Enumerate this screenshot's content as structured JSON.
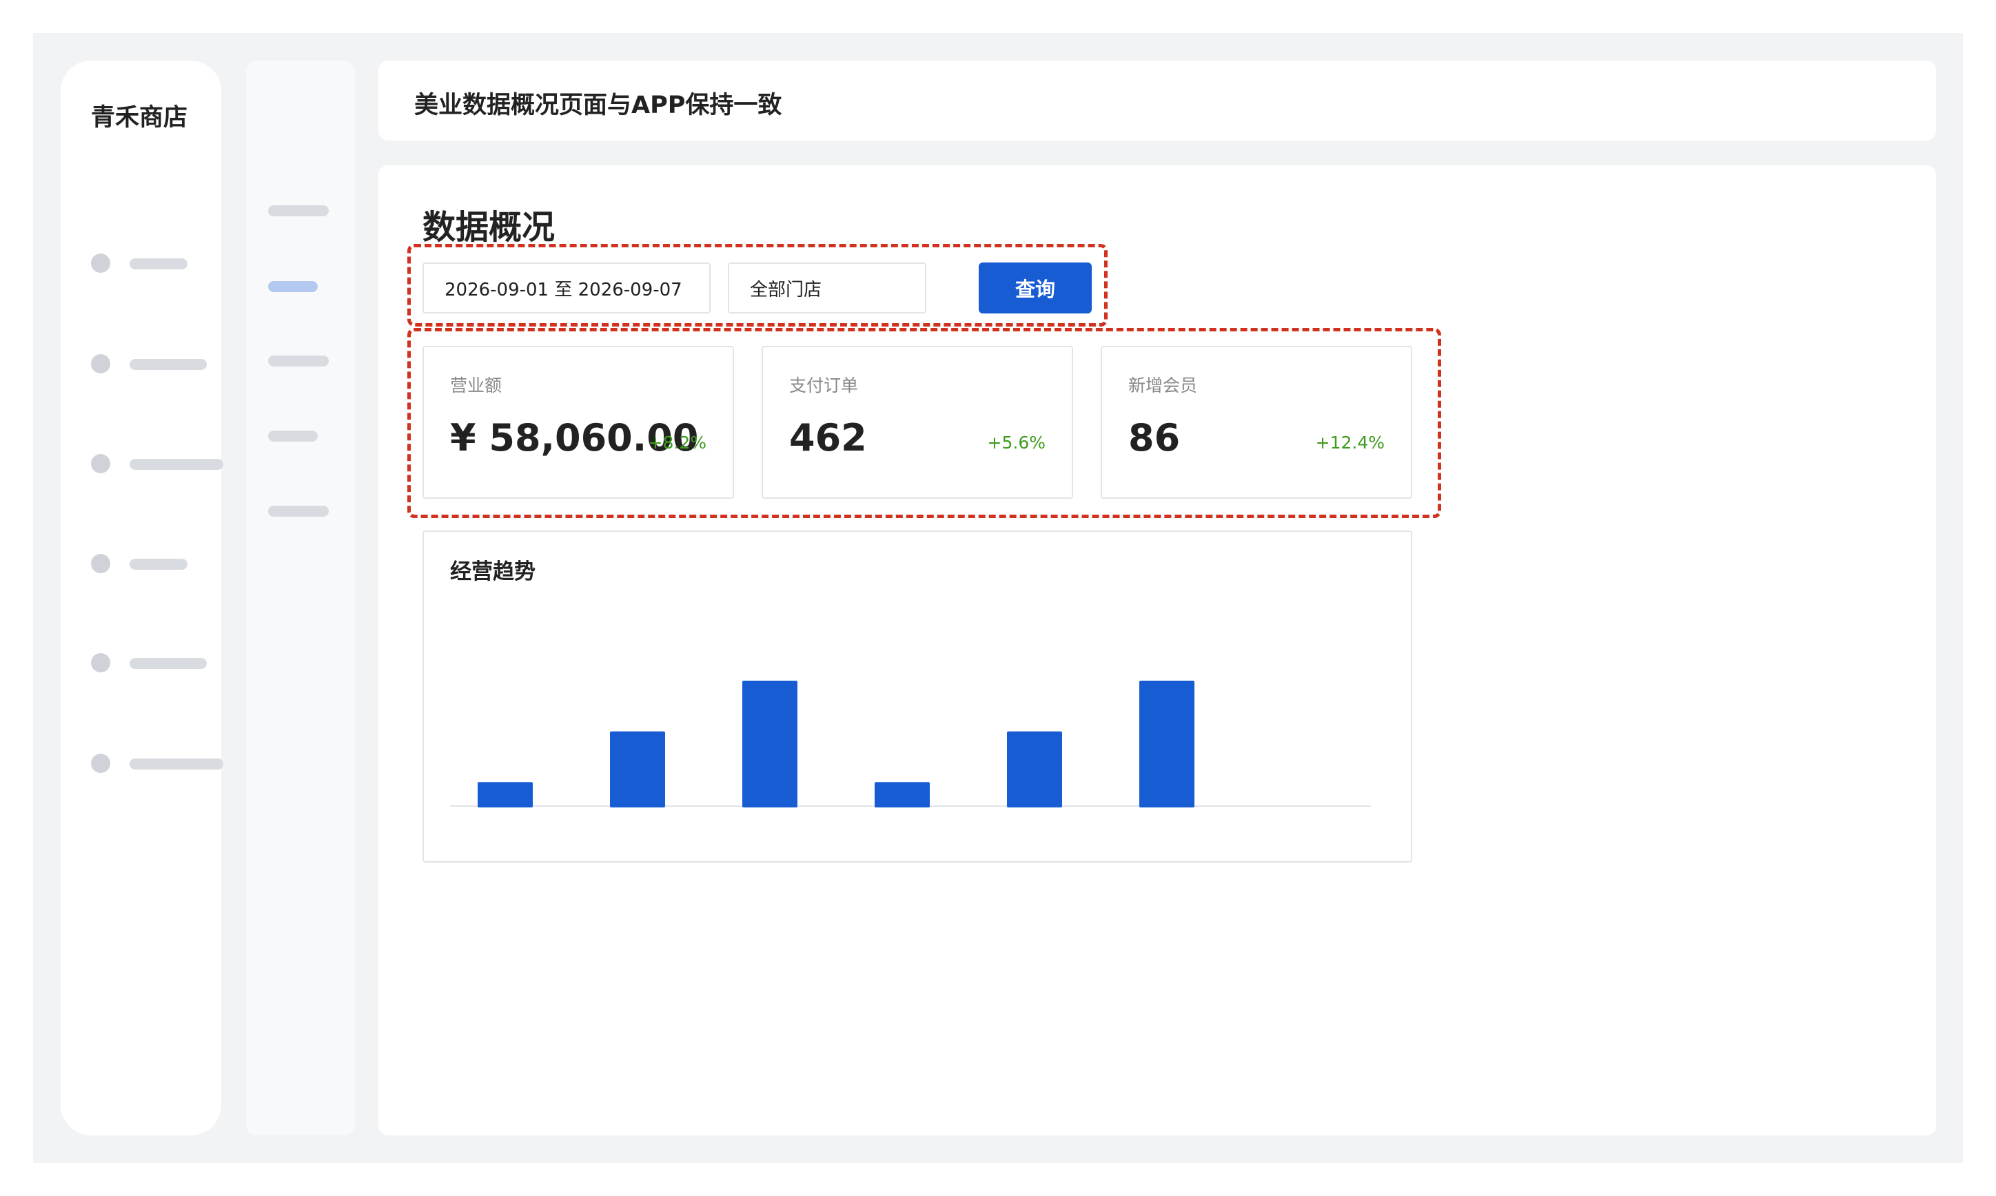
{
  "brand": {
    "name": "青禾商店"
  },
  "topbar": {
    "title": "美业数据概况页面与APP保持一致"
  },
  "main": {
    "title": "数据概况",
    "filters": {
      "date_range": "2026-09-01 至 2026-09-07",
      "store": "全部门店",
      "query_label": "查询"
    },
    "metrics": [
      {
        "label": "营业额",
        "value": "¥ 58,060.00",
        "delta": "+8.2%"
      },
      {
        "label": "支付订单",
        "value": "462",
        "delta": "+5.6%"
      },
      {
        "label": "新增会员",
        "value": "86",
        "delta": "+12.4%"
      }
    ],
    "chart": {
      "title": "经营趋势"
    }
  },
  "colors": {
    "accent": "#175cd3",
    "positive": "#3f9c1e",
    "highlight_outline": "#d0321e",
    "subnav_active": "#b4c9f0"
  },
  "chart_data": {
    "type": "bar",
    "categories": [
      "",
      "",
      "",
      "",
      "",
      ""
    ],
    "values": [
      1,
      3,
      5,
      1,
      3,
      5
    ],
    "title": "经营趋势",
    "xlabel": "",
    "ylabel": "",
    "ylim": [
      0,
      5
    ],
    "grid": false,
    "legend": "none"
  }
}
